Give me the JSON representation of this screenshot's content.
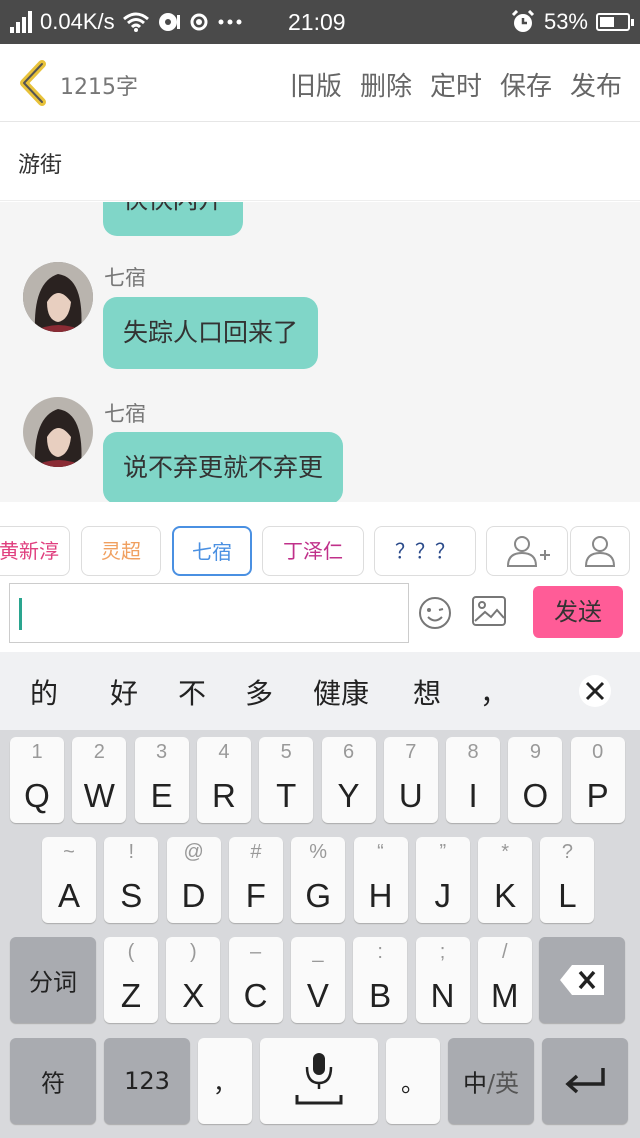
{
  "status_bar": {
    "net_speed": "0.04K/s",
    "time": "21:09",
    "battery_percent": "53%",
    "battery_level": 0.53,
    "icons": [
      "signal-icon",
      "wifi-icon",
      "media-icon",
      "location-icon",
      "more-icon",
      "alarm-icon",
      "battery-icon"
    ]
  },
  "header": {
    "word_count": "1215字",
    "actions": [
      "旧版",
      "删除",
      "定时",
      "保存",
      "发布"
    ]
  },
  "title": "游街",
  "chat": {
    "partial_bubble": "快快闪开",
    "messages": [
      {
        "name": "七宿",
        "text": "失踪人口回来了"
      },
      {
        "name": "七宿",
        "text": "说不弃更就不弃更"
      }
    ]
  },
  "characters": [
    {
      "label": "黄新淳",
      "color": "#e0407f"
    },
    {
      "label": "灵超",
      "color": "#f0a060"
    },
    {
      "label": "七宿",
      "color": "#4a90e2"
    },
    {
      "label": "丁泽仁",
      "color": "#c0308a"
    },
    {
      "label": "？？？",
      "color": "#2a4a8a"
    }
  ],
  "input": {
    "value": "",
    "send_label": "发送"
  },
  "keyboard": {
    "candidates": [
      "的",
      "好",
      "不",
      "多",
      "健康",
      "想",
      "，"
    ],
    "row1": [
      {
        "sub": "1",
        "key": "Q"
      },
      {
        "sub": "2",
        "key": "W"
      },
      {
        "sub": "3",
        "key": "E"
      },
      {
        "sub": "4",
        "key": "R"
      },
      {
        "sub": "5",
        "key": "T"
      },
      {
        "sub": "6",
        "key": "Y"
      },
      {
        "sub": "7",
        "key": "U"
      },
      {
        "sub": "8",
        "key": "I"
      },
      {
        "sub": "9",
        "key": "O"
      },
      {
        "sub": "0",
        "key": "P"
      }
    ],
    "row2": [
      {
        "sub": "~",
        "key": "A"
      },
      {
        "sub": "!",
        "key": "S"
      },
      {
        "sub": "@",
        "key": "D"
      },
      {
        "sub": "#",
        "key": "F"
      },
      {
        "sub": "%",
        "key": "G"
      },
      {
        "sub": "“",
        "key": "H"
      },
      {
        "sub": "”",
        "key": "J"
      },
      {
        "sub": "*",
        "key": "K"
      },
      {
        "sub": "?",
        "key": "L"
      }
    ],
    "row3": [
      {
        "sub": "(",
        "key": "Z"
      },
      {
        "sub": ")",
        "key": "X"
      },
      {
        "sub": "–",
        "key": "C"
      },
      {
        "sub": "_",
        "key": "V"
      },
      {
        "sub": ":",
        "key": "B"
      },
      {
        "sub": ";",
        "key": "N"
      },
      {
        "sub": "/",
        "key": "M"
      }
    ],
    "segment_label": "分词",
    "symbol_label": "符",
    "number_label": "123",
    "comma_label": "，",
    "period_label": "。",
    "lang_label_cn": "中",
    "lang_label_en": "/英"
  }
}
